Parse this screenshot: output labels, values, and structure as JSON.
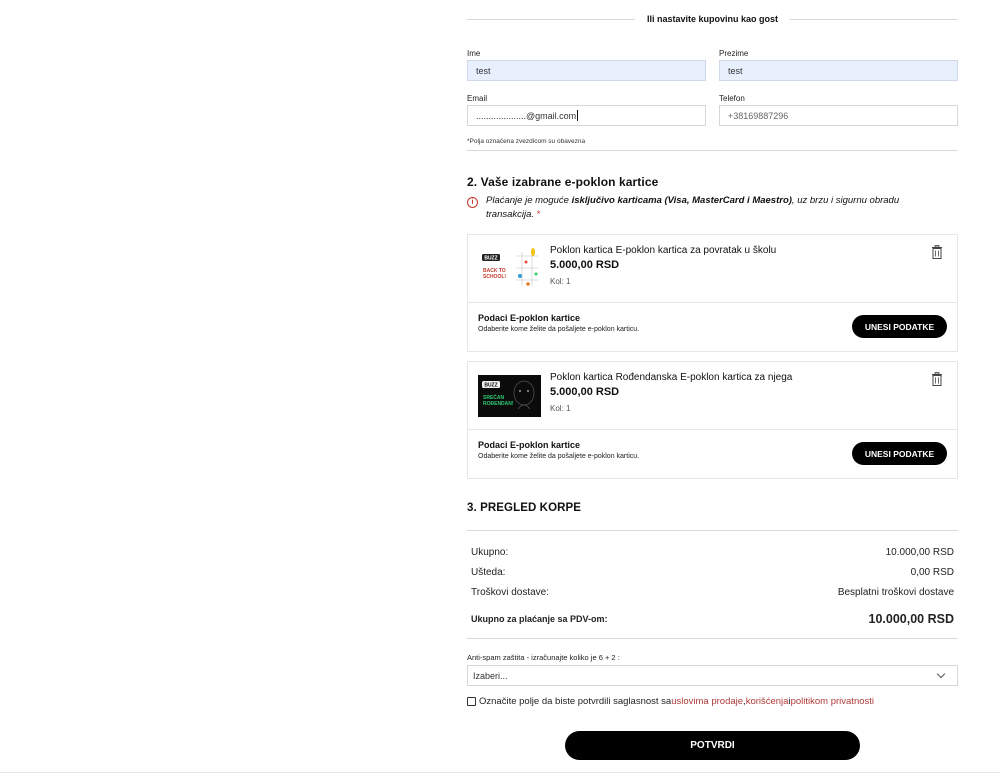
{
  "guest_section": {
    "title": "Ili nastavite kupovinu kao gost"
  },
  "form": {
    "first_name_label": "Ime",
    "first_name_value": "test",
    "last_name_label": "Prezime",
    "last_name_value": "test",
    "email_label": "Email",
    "email_value": "....................@gmail.com",
    "phone_label": "Telefon",
    "phone_value": "+38169887296",
    "required_note": "*Polja označena zvezdicom su obavezna"
  },
  "gift_cards_section": {
    "heading": "2. Vaše izabrane e-poklon kartice",
    "info_pre": "Plaćanje je moguće ",
    "info_bold": "isključivo karticama (Visa, MasterCard i Maestro)",
    "info_post": ", uz brzu i sigurnu obradu transakcija.",
    "info_required": " *",
    "items": [
      {
        "title": "Poklon kartica E-poklon kartica za povratak u školu",
        "price": "5.000,00 RSD",
        "qty": "Kol: 1",
        "thumb_brand": "BUZZ",
        "thumb_text_1": "BACK TO",
        "thumb_text_2": "SCHOOL!",
        "details_title": "Podaci E-poklon kartice",
        "details_sub": "Odaberite kome želite da pošaljete e-poklon karticu.",
        "button": "UNESI PODATKE"
      },
      {
        "title": "Poklon kartica Rođendanska E-poklon kartica za njega",
        "price": "5.000,00 RSD",
        "qty": "Kol: 1",
        "thumb_brand": "BUZZ",
        "thumb_text_1": "SREĆAN",
        "thumb_text_2": "ROĐENDAN!",
        "details_title": "Podaci E-poklon kartice",
        "details_sub": "Odaberite kome želite da pošaljete e-poklon karticu.",
        "button": "UNESI PODATKE"
      }
    ]
  },
  "cart_review": {
    "heading": "3. PREGLED KORPE",
    "subtotal_label": "Ukupno:",
    "subtotal_value": "10.000,00 RSD",
    "savings_label": "Ušteda:",
    "savings_value": "0,00 RSD",
    "shipping_label": "Troškovi dostave:",
    "shipping_value": "Besplatni troškovi dostave",
    "total_label": "Ukupno za plaćanje sa PDV-om:",
    "total_value": "10.000,00 RSD"
  },
  "antispam": {
    "label": "Anti-spam zaštita - izračunajte koliko je 6 + 2 :",
    "selected": "Izaberi..."
  },
  "consent": {
    "text": "Označite polje da biste potvrdili saglasnost sa ",
    "link1": "uslovima prodaje",
    "sep": ", ",
    "link2": "korišćenja",
    "and": " i ",
    "link3": "politikom privatnosti"
  },
  "submit_label": "POTVRDI",
  "colors": {
    "accent_red": "#b03a3a",
    "autofill_blue": "#e8f0fe",
    "button_black": "#000000"
  }
}
